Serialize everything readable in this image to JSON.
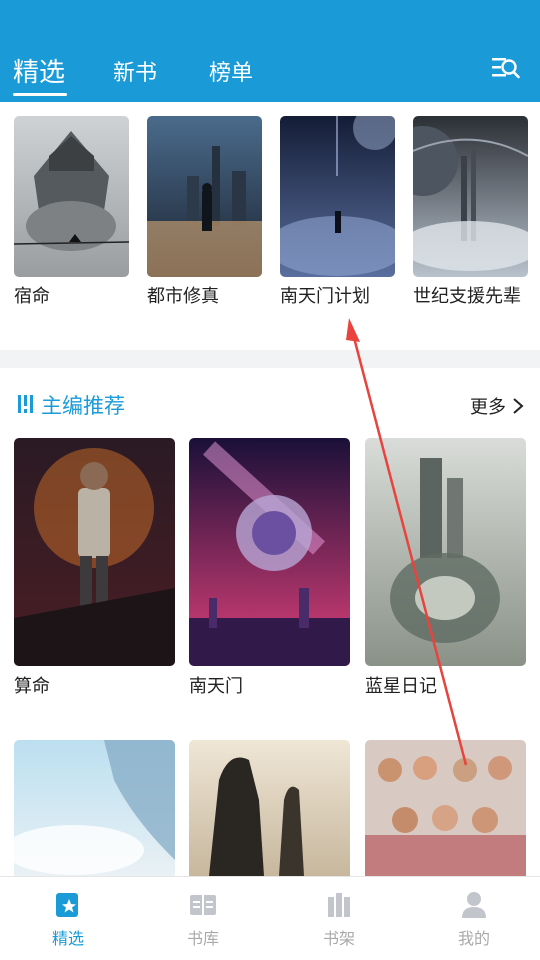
{
  "header": {
    "tabs": [
      {
        "label": "精选"
      },
      {
        "label": "新书"
      },
      {
        "label": "榜单"
      }
    ]
  },
  "top_strip": {
    "books": [
      {
        "title": "宿命"
      },
      {
        "title": "都市修真"
      },
      {
        "title": "南天门计划"
      },
      {
        "title": "世纪支援先辈"
      }
    ]
  },
  "editor_section": {
    "title": "主编推荐",
    "more_label": "更多",
    "books_row1": [
      {
        "title": "算命"
      },
      {
        "title": "南天门"
      },
      {
        "title": "蓝星日记"
      }
    ]
  },
  "bottom_nav": {
    "items": [
      {
        "label": "精选",
        "icon": "star-book-icon"
      },
      {
        "label": "书库",
        "icon": "open-book-icon"
      },
      {
        "label": "书架",
        "icon": "bookshelf-icon"
      },
      {
        "label": "我的",
        "icon": "person-icon"
      }
    ]
  },
  "colors": {
    "accent": "#1a9bd7",
    "arrow": "#e8433d"
  }
}
